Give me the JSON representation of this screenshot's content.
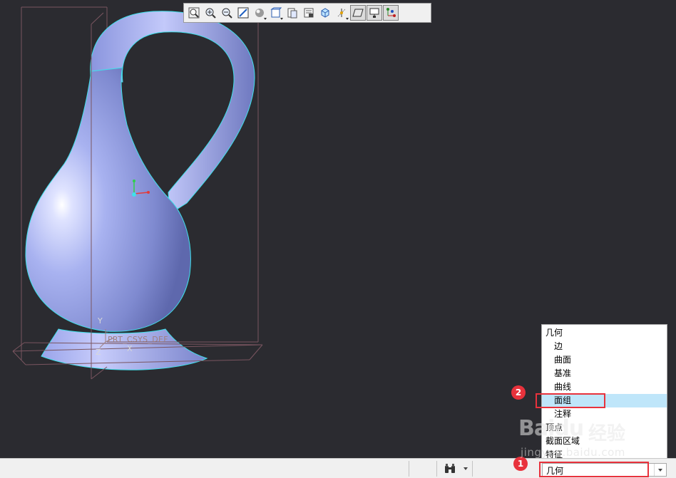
{
  "viewport": {
    "background": "#2b2b30",
    "axis_labels": {
      "y": "Y",
      "z": "Z",
      "x": "X"
    },
    "csys_label": "PRT_CSYS_DEF",
    "model_color": "#a8b2f0"
  },
  "graphics_toolbar": {
    "buttons": [
      {
        "icon": "refit-icon"
      },
      {
        "icon": "zoom-in-icon"
      },
      {
        "icon": "zoom-out-icon"
      },
      {
        "icon": "repaint-icon"
      },
      {
        "icon": "display-style-icon"
      },
      {
        "icon": "saved-orientations-icon"
      },
      {
        "icon": "view-manager-icon"
      },
      {
        "icon": "named-views-icon"
      },
      {
        "icon": "spin-center-icon"
      },
      {
        "icon": "datum-display-icon"
      },
      {
        "icon": "plane-display-icon"
      },
      {
        "icon": "annotation-display-icon"
      },
      {
        "icon": "csys-display-icon"
      }
    ]
  },
  "status_bar": {
    "find_icon": "binoculars-icon",
    "filter": {
      "value": "几何"
    }
  },
  "filter_dropdown": {
    "options": [
      {
        "label": "几何",
        "level": "top"
      },
      {
        "label": "边",
        "level": "sub"
      },
      {
        "label": "曲面",
        "level": "sub"
      },
      {
        "label": "基准",
        "level": "sub"
      },
      {
        "label": "曲线",
        "level": "sub"
      },
      {
        "label": "面组",
        "level": "sub",
        "selected": true
      },
      {
        "label": "注释",
        "level": "sub"
      },
      {
        "label": "顶点",
        "level": "top"
      },
      {
        "label": "截面区域",
        "level": "top"
      },
      {
        "label": "特征",
        "level": "top"
      }
    ]
  },
  "annotations": {
    "marker_1": "1",
    "marker_2": "2",
    "highlight_color": "#e8323c"
  },
  "watermark": {
    "logo": "Baidu",
    "brand": "经验",
    "url": "jingyan.baidu.com"
  }
}
